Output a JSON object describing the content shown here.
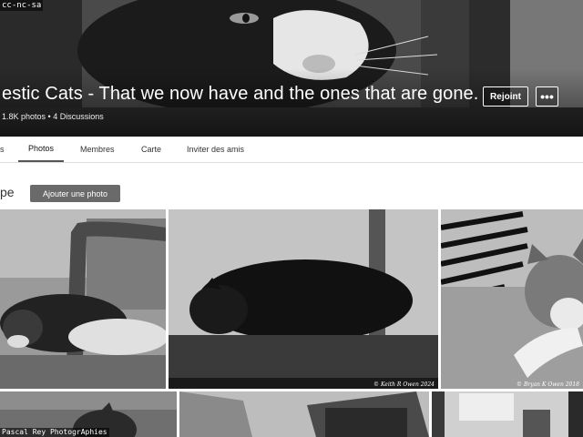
{
  "license": "cc-nc-sa",
  "group": {
    "title": "estic Cats - That we now have and the ones that are gone.",
    "meta": "1.8K photos • 4 Discussions",
    "joined_label": "Rejoint",
    "more_label": "•••"
  },
  "tabs": [
    {
      "label": "s",
      "active": false
    },
    {
      "label": "Photos",
      "active": true
    },
    {
      "label": "Membres",
      "active": false
    },
    {
      "label": "Carte",
      "active": false
    },
    {
      "label": "Inviter des amis",
      "active": false
    }
  ],
  "section": {
    "title": "pe",
    "add_photo_label": "Ajouter une photo"
  },
  "photos": [
    {
      "credit": ""
    },
    {
      "credit": "© Keith R Owen 2024"
    },
    {
      "credit": "© Bryan K Owen 2018"
    },
    {
      "credit": ""
    },
    {
      "credit": ""
    },
    {
      "credit": ""
    }
  ],
  "watermark": "Pascal Rey PhotogrAphies"
}
